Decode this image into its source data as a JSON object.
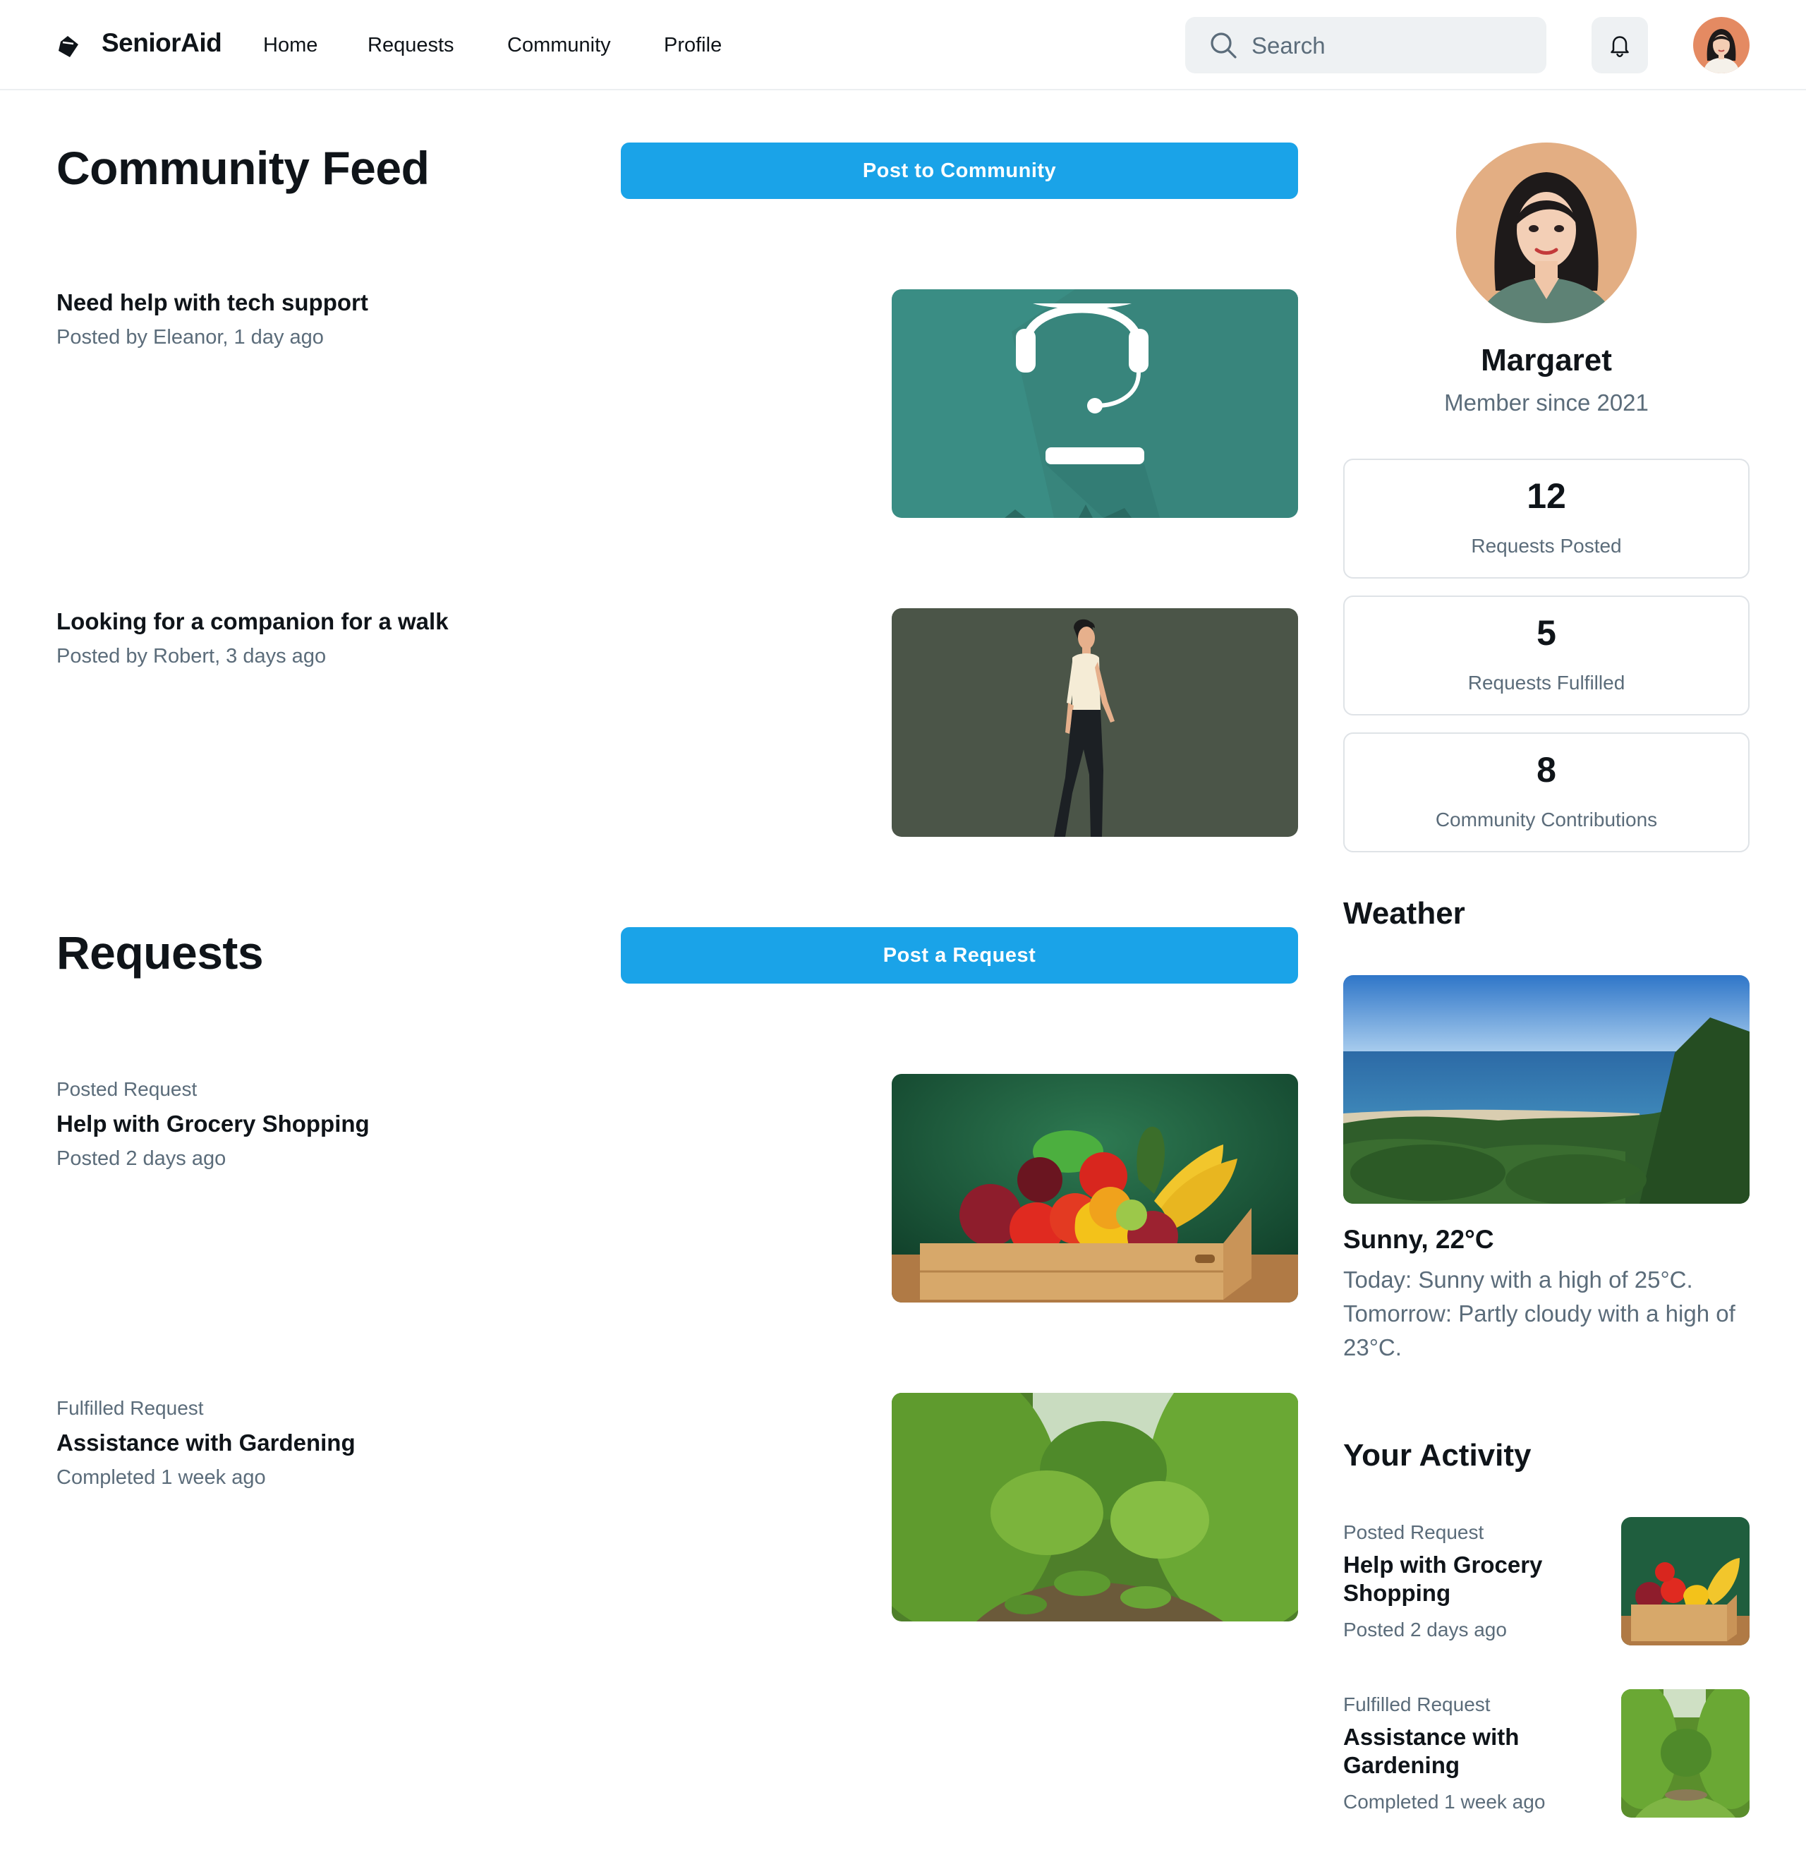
{
  "app": {
    "name": "SeniorAid"
  },
  "nav": {
    "items": [
      "Home",
      "Requests",
      "Community",
      "Profile"
    ]
  },
  "search": {
    "placeholder": "Search"
  },
  "colors": {
    "accent": "#1aa3e8",
    "muted_text": "#5b6c7a",
    "border": "#dfe3e7",
    "search_bg": "#eef1f3"
  },
  "icons": {
    "logo": "diamond-logo-icon",
    "search": "search-icon",
    "notifications": "bell-icon"
  },
  "community": {
    "title": "Community Feed",
    "post_button": "Post to Community",
    "posts": [
      {
        "title": "Need help with tech support",
        "meta": "Posted by Eleanor, 1 day ago",
        "image": "headset-illustration"
      },
      {
        "title": "Looking for a companion for a walk",
        "meta": "Posted by Robert, 3 days ago",
        "image": "walking-man-illustration"
      }
    ]
  },
  "requests": {
    "title": "Requests",
    "post_button": "Post a Request",
    "items": [
      {
        "kicker": "Posted Request",
        "title": "Help with Grocery Shopping",
        "meta": "Posted 2 days ago",
        "image": "grocery-crate-photo"
      },
      {
        "kicker": "Fulfilled Request",
        "title": "Assistance with Gardening",
        "meta": "Completed 1 week ago",
        "image": "garden-photo"
      }
    ]
  },
  "profile": {
    "name": "Margaret",
    "since": "Member since 2021",
    "stats": [
      {
        "value": "12",
        "label": "Requests Posted"
      },
      {
        "value": "5",
        "label": "Requests Fulfilled"
      },
      {
        "value": "8",
        "label": "Community Contributions"
      }
    ]
  },
  "weather": {
    "title": "Weather",
    "condition": "Sunny, 22°C",
    "description": "Today: Sunny with a high of 25°C. Tomorrow: Partly cloudy with a high of 23°C."
  },
  "activity": {
    "title": "Your Activity",
    "items": [
      {
        "kicker": "Posted Request",
        "title": "Help with Grocery Shopping",
        "meta": "Posted 2 days ago"
      },
      {
        "kicker": "Fulfilled Request",
        "title": "Assistance with Gardening",
        "meta": "Completed 1 week ago"
      }
    ]
  }
}
